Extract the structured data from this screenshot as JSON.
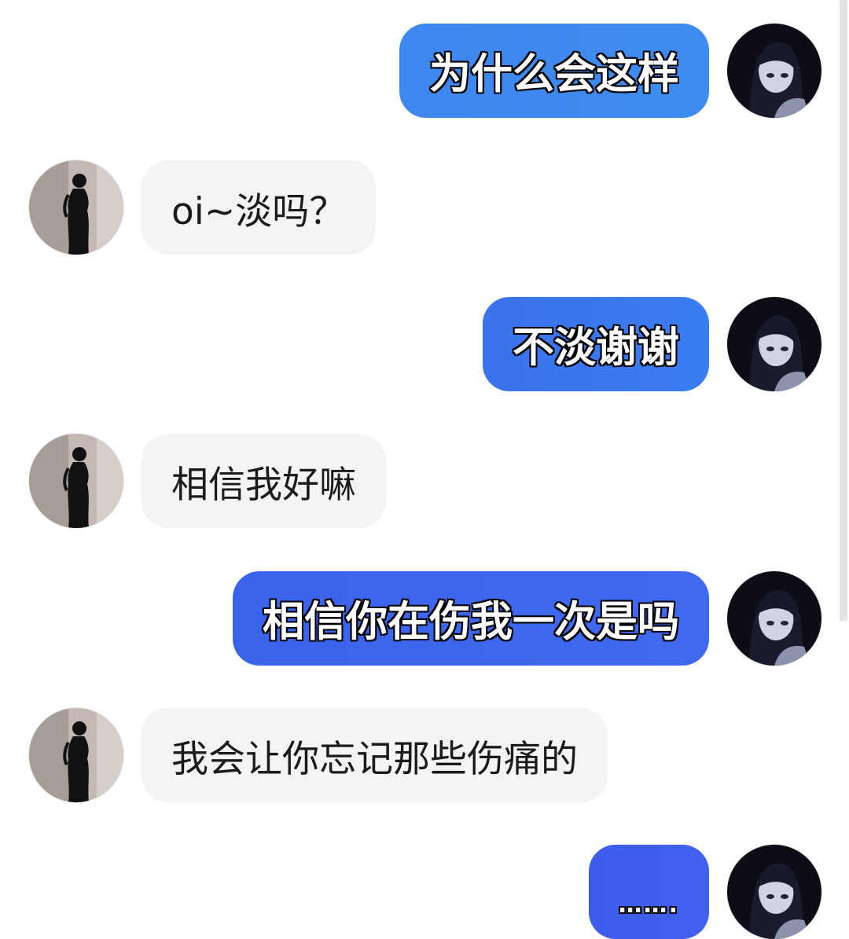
{
  "messages": [
    {
      "direction": "outgoing",
      "text": "为什么会这样"
    },
    {
      "direction": "incoming",
      "text": "oi~淡吗？"
    },
    {
      "direction": "outgoing",
      "text": "不淡谢谢"
    },
    {
      "direction": "incoming",
      "text": "相信我好嘛"
    },
    {
      "direction": "outgoing",
      "text": "相信你在伤我一次是吗"
    },
    {
      "direction": "incoming",
      "text": "我会让你忘记那些伤痛的"
    },
    {
      "direction": "outgoing",
      "text": "……."
    }
  ],
  "colors": {
    "incoming_bubble": "#f4f4f5",
    "outgoing_bubble_top": "#3f86ee",
    "outgoing_bubble_bottom": "#3d5cea",
    "outgoing_text": "#ffffff",
    "incoming_text": "#1b1b1b"
  },
  "icons": {
    "self_avatar": "anime-girl-avatar-icon",
    "other_avatar": "silhouette-woman-avatar-icon"
  }
}
